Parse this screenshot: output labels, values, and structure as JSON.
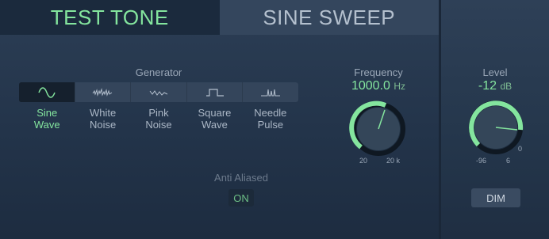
{
  "tabs": [
    {
      "label": "TEST TONE",
      "active": true
    },
    {
      "label": "SINE SWEEP",
      "active": false
    }
  ],
  "generator": {
    "title": "Generator",
    "waveforms": [
      {
        "label": "Sine\nWave",
        "icon": "sine-wave-icon",
        "selected": true
      },
      {
        "label": "White\nNoise",
        "icon": "white-noise-icon",
        "selected": false
      },
      {
        "label": "Pink\nNoise",
        "icon": "pink-noise-icon",
        "selected": false
      },
      {
        "label": "Square\nWave",
        "icon": "square-wave-icon",
        "selected": false
      },
      {
        "label": "Needle\nPulse",
        "icon": "needle-pulse-icon",
        "selected": false
      }
    ]
  },
  "anti_aliased": {
    "title": "Anti Aliased",
    "button": "ON"
  },
  "frequency": {
    "title": "Frequency",
    "value": "1000.0",
    "unit": "Hz",
    "min_label": "20",
    "max_label": "20 k"
  },
  "level": {
    "title": "Level",
    "value": "-12",
    "unit": "dB",
    "min_label": "-96",
    "max_label": "6",
    "zero_label": "0",
    "dim_button": "DIM"
  },
  "colors": {
    "accent": "#84e59e",
    "background": "#23344a"
  }
}
